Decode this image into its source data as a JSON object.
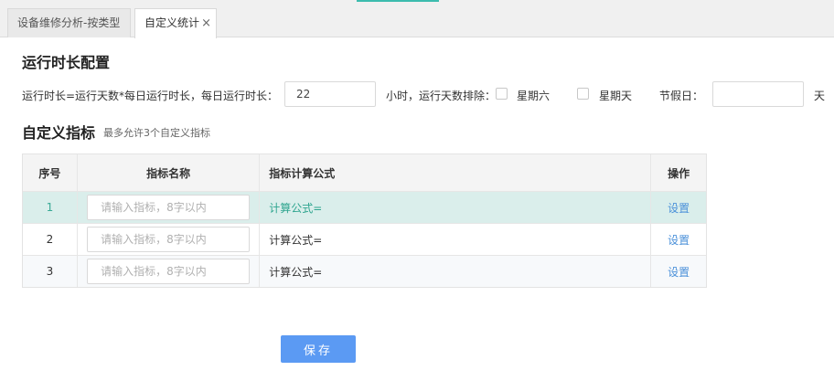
{
  "tabs": [
    {
      "label": "设备维修分析-按类型"
    },
    {
      "label": "自定义统计",
      "close_icon": "×"
    }
  ],
  "runtime": {
    "title": "运行时长配置",
    "formula_label": "运行时长=运行天数*每日运行时长，每日运行时长：",
    "hours_value": "22",
    "hours_unit_label": "小时，运行天数排除：",
    "saturday_label": "星期六",
    "sunday_label": "星期天",
    "holiday_label": "节假日：",
    "holiday_value": "",
    "holiday_unit": "天"
  },
  "custom": {
    "title": "自定义指标",
    "hint": "最多允许3个自定义指标"
  },
  "table": {
    "headers": {
      "index": "序号",
      "name": "指标名称",
      "formula": "指标计算公式",
      "action": "操作"
    },
    "placeholder": "请输入指标，8字以内",
    "rows": [
      {
        "index": "1",
        "formula": "计算公式=",
        "action": "设置"
      },
      {
        "index": "2",
        "formula": "计算公式=",
        "action": "设置"
      },
      {
        "index": "3",
        "formula": "计算公式=",
        "action": "设置"
      }
    ]
  },
  "save_label": "保存"
}
